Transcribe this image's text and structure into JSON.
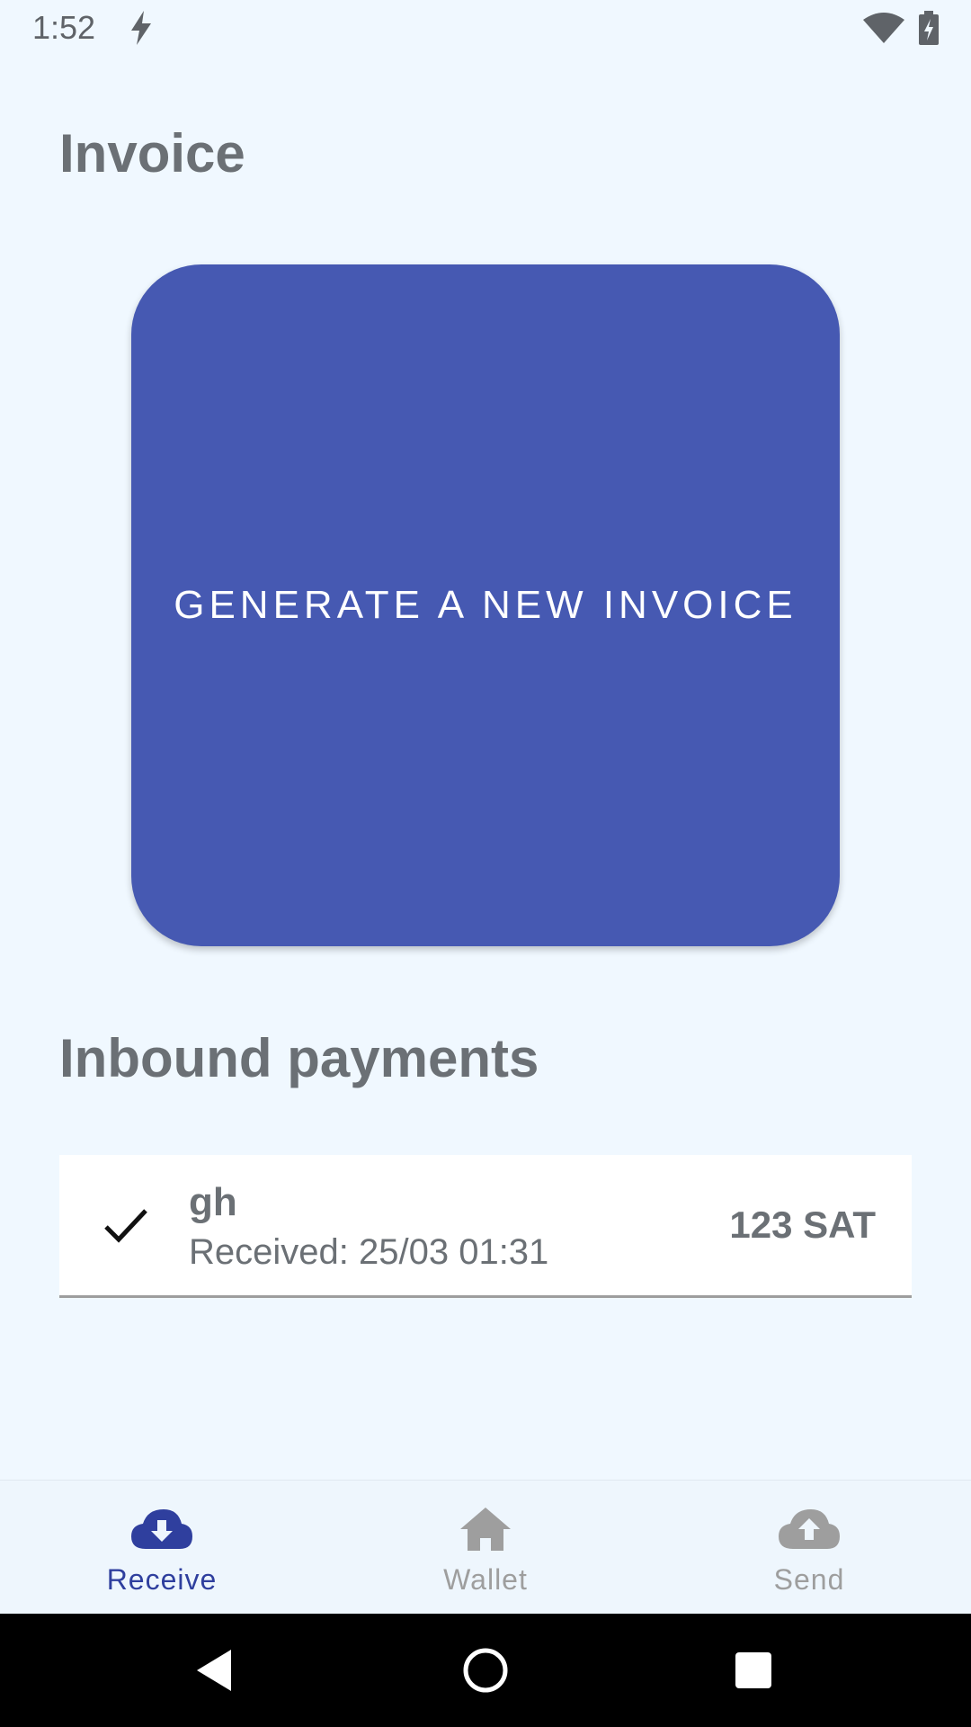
{
  "status_bar": {
    "time": "1:52"
  },
  "page": {
    "title": "Invoice"
  },
  "generate": {
    "label": "GENERATE A NEW INVOICE"
  },
  "inbound": {
    "title": "Inbound payments",
    "payments": [
      {
        "name": "gh",
        "received": "Received: 25/03 01:31",
        "amount": "123 SAT",
        "status_icon": "check-icon"
      }
    ]
  },
  "bottom_nav": {
    "items": [
      {
        "label": "Receive",
        "icon": "cloud-download-icon",
        "active": true
      },
      {
        "label": "Wallet",
        "icon": "home-icon",
        "active": false
      },
      {
        "label": "Send",
        "icon": "cloud-upload-icon",
        "active": false
      }
    ]
  },
  "colors": {
    "background": "#f0f8ff",
    "primary": "#4659b2",
    "nav_active": "#2f3f9e",
    "nav_inactive": "#9e9e9e",
    "text_secondary": "#6b7075"
  }
}
